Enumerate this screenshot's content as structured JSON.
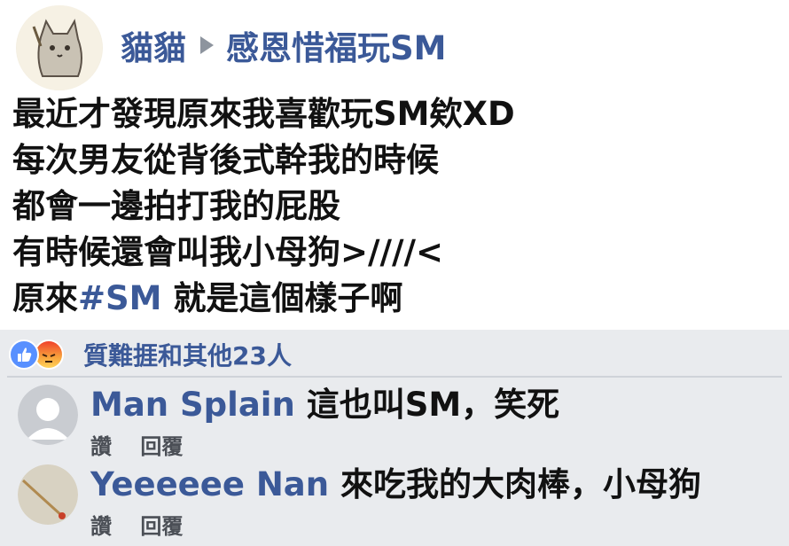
{
  "post": {
    "author": "貓貓",
    "group": "感恩惜福玩SM",
    "lines": [
      "最近才發現原來我喜歡玩SM欸XD",
      "每次男友從背後式幹我的時候",
      "都會一邊拍打我的屁股",
      "有時候還會叫我小母狗>////<"
    ],
    "last_line": {
      "before": "原來",
      "hashtag": "#SM",
      "after": " 就是這個樣子啊"
    }
  },
  "reactions": {
    "text": "質難捱和其他23人",
    "icons": [
      "like-icon",
      "angry-icon"
    ]
  },
  "comments": [
    {
      "name": "Man Splain",
      "text": "這也叫SM，笑死",
      "like": "讚",
      "reply": "回覆"
    },
    {
      "name": "Yeeeeee Nan",
      "text": "來吃我的大肉棒，小母狗",
      "like": "讚",
      "reply": "回覆"
    }
  ],
  "colors": {
    "link": "#3b5998",
    "comment_bg": "#e9ebee",
    "like_blue": "#5890ff"
  }
}
